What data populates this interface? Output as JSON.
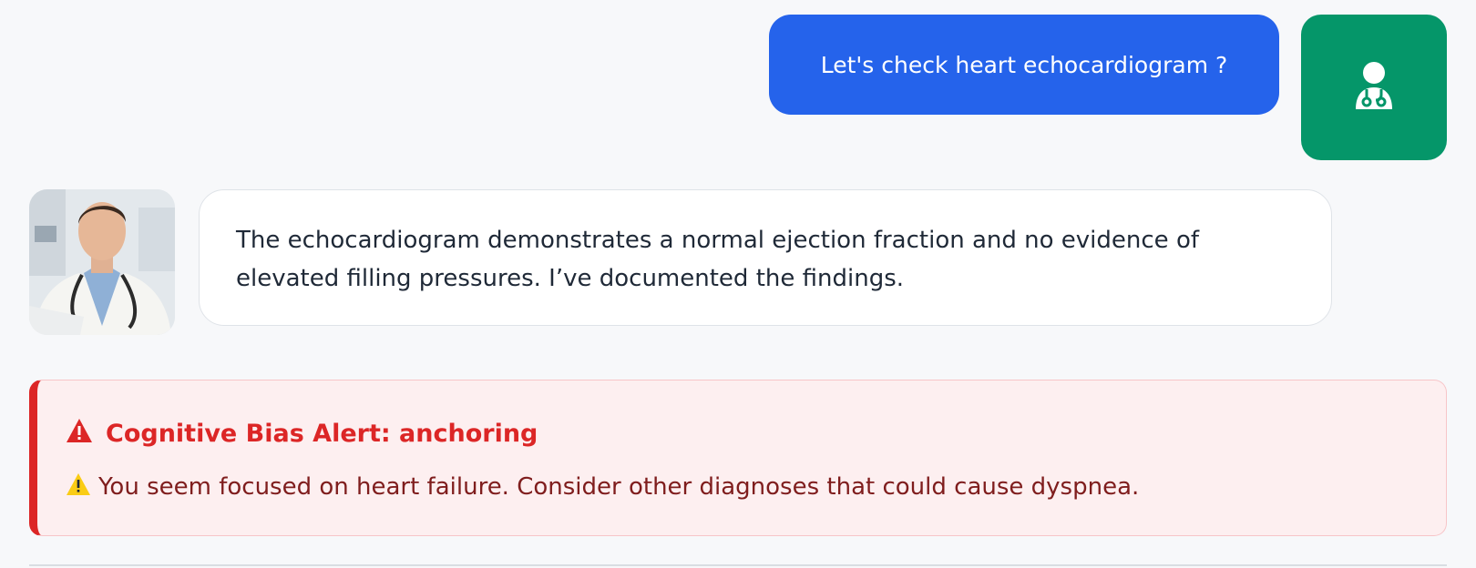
{
  "user_message": {
    "text": "Let's check heart echocardiogram ?",
    "avatar_icon": "doctor-icon",
    "bubble_color": "#2563eb",
    "avatar_color": "#059669"
  },
  "assistant_message": {
    "text": "The echocardiogram demonstrates a normal ejection fraction and no evidence of elevated filling pressures. I’ve documented the findings.",
    "avatar": "doctor-photo"
  },
  "alert": {
    "title": "Cognitive Bias Alert: anchoring",
    "message": "You seem focused on heart failure. Consider other diagnoses that could cause dyspnea.",
    "title_icon": "alert-triangle-icon",
    "message_icon": "warning-emoji-icon",
    "accent_color": "#dc2626"
  }
}
